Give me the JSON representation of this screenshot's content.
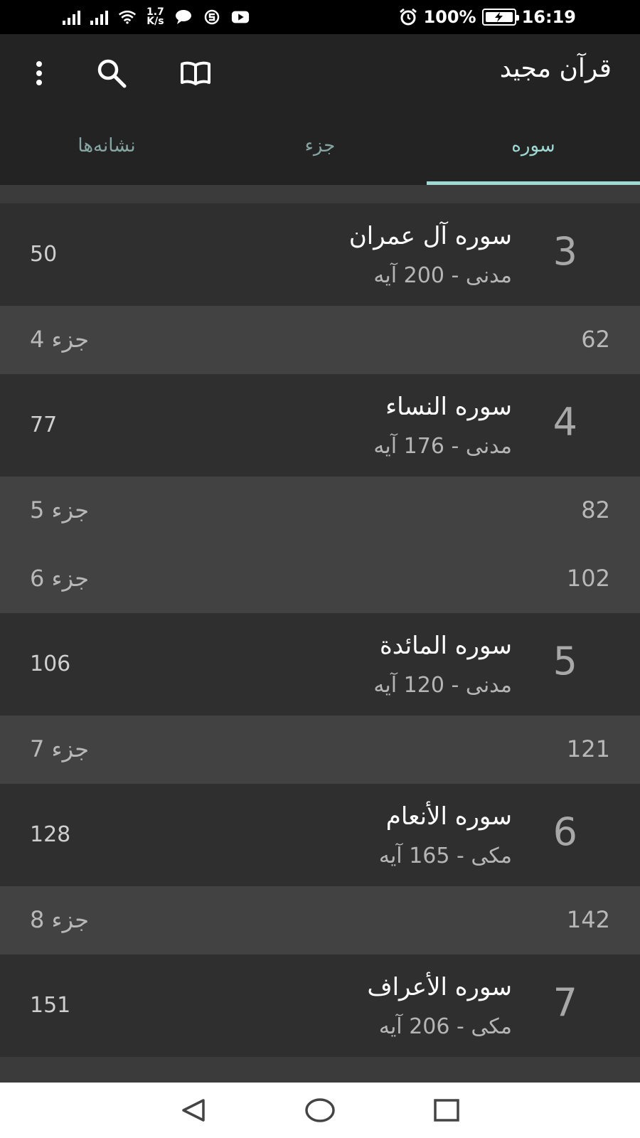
{
  "status_bar": {
    "speed_value": "1.7",
    "speed_unit": "K/s",
    "battery_percent": "100%",
    "time": "16:19"
  },
  "app_bar": {
    "title": "قرآن مجید",
    "icons": [
      "book-icon",
      "search-icon",
      "more-vert-icon"
    ]
  },
  "tabs": [
    {
      "label": "سوره",
      "active": true
    },
    {
      "label": "جزء",
      "active": false
    },
    {
      "label": "نشانه‌ها",
      "active": false
    }
  ],
  "list": {
    "surahs": [
      {
        "number": "3",
        "name": "سوره آل عمران",
        "meta": "مدنی - 200 آیه",
        "page": "50"
      },
      {
        "number": "4",
        "name": "سوره النساء",
        "meta": "مدنی - 176 آیه",
        "page": "77"
      },
      {
        "number": "5",
        "name": "سوره المائدة",
        "meta": "مدنی - 120 آیه",
        "page": "106"
      },
      {
        "number": "6",
        "name": "سوره الأنعام",
        "meta": "مکی - 165 آیه",
        "page": "128"
      },
      {
        "number": "7",
        "name": "سوره الأعراف",
        "meta": "مکی - 206 آیه",
        "page": "151"
      }
    ],
    "juz": [
      {
        "label": "جزء 4",
        "page": "62"
      },
      {
        "label": "جزء 5",
        "page": "82"
      },
      {
        "label": "جزء 6",
        "page": "102"
      },
      {
        "label": "جزء 7",
        "page": "121"
      },
      {
        "label": "جزء 8",
        "page": "142"
      }
    ]
  },
  "nav_bar": {
    "icons": [
      "back-icon",
      "home-icon",
      "recents-icon"
    ]
  },
  "colors": {
    "accent": "#9fd9d4",
    "app_bar": "#232323",
    "row_bg": "#2f2f2f",
    "juz_bg": "#424242"
  }
}
